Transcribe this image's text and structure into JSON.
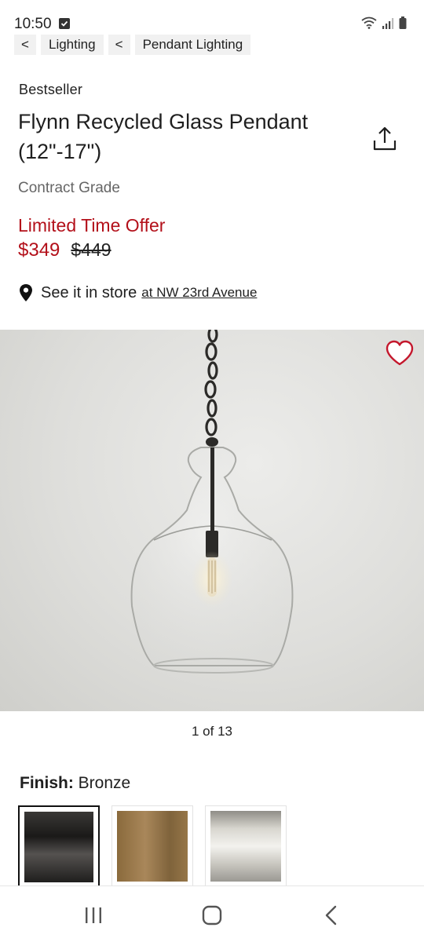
{
  "status_bar": {
    "time": "10:50"
  },
  "breadcrumb": {
    "items": [
      {
        "back": "<",
        "label": "Lighting"
      },
      {
        "back": "<",
        "label": "Pendant Lighting"
      }
    ]
  },
  "product": {
    "badge": "Bestseller",
    "title": "Flynn Recycled Glass Pendant (12\"-17\")",
    "grade": "Contract Grade",
    "offer_label": "Limited Time Offer",
    "sale_price": "$349",
    "original_price": "$449"
  },
  "store": {
    "label": "See it in store",
    "link": "at NW 23rd Avenue"
  },
  "gallery": {
    "counter": "1 of 13"
  },
  "finish": {
    "label": "Finish:",
    "value": "Bronze",
    "options": [
      "bronze",
      "brass",
      "polished-nickel"
    ],
    "selected_index": 0
  },
  "colors": {
    "sale_red": "#b3101a",
    "heart_red": "#c4172c"
  },
  "icons": {
    "share": "share-icon",
    "favorite": "heart-icon",
    "location": "location-pin-icon",
    "nav_recent": "recent-apps-icon",
    "nav_home": "home-icon",
    "nav_back": "back-icon"
  }
}
